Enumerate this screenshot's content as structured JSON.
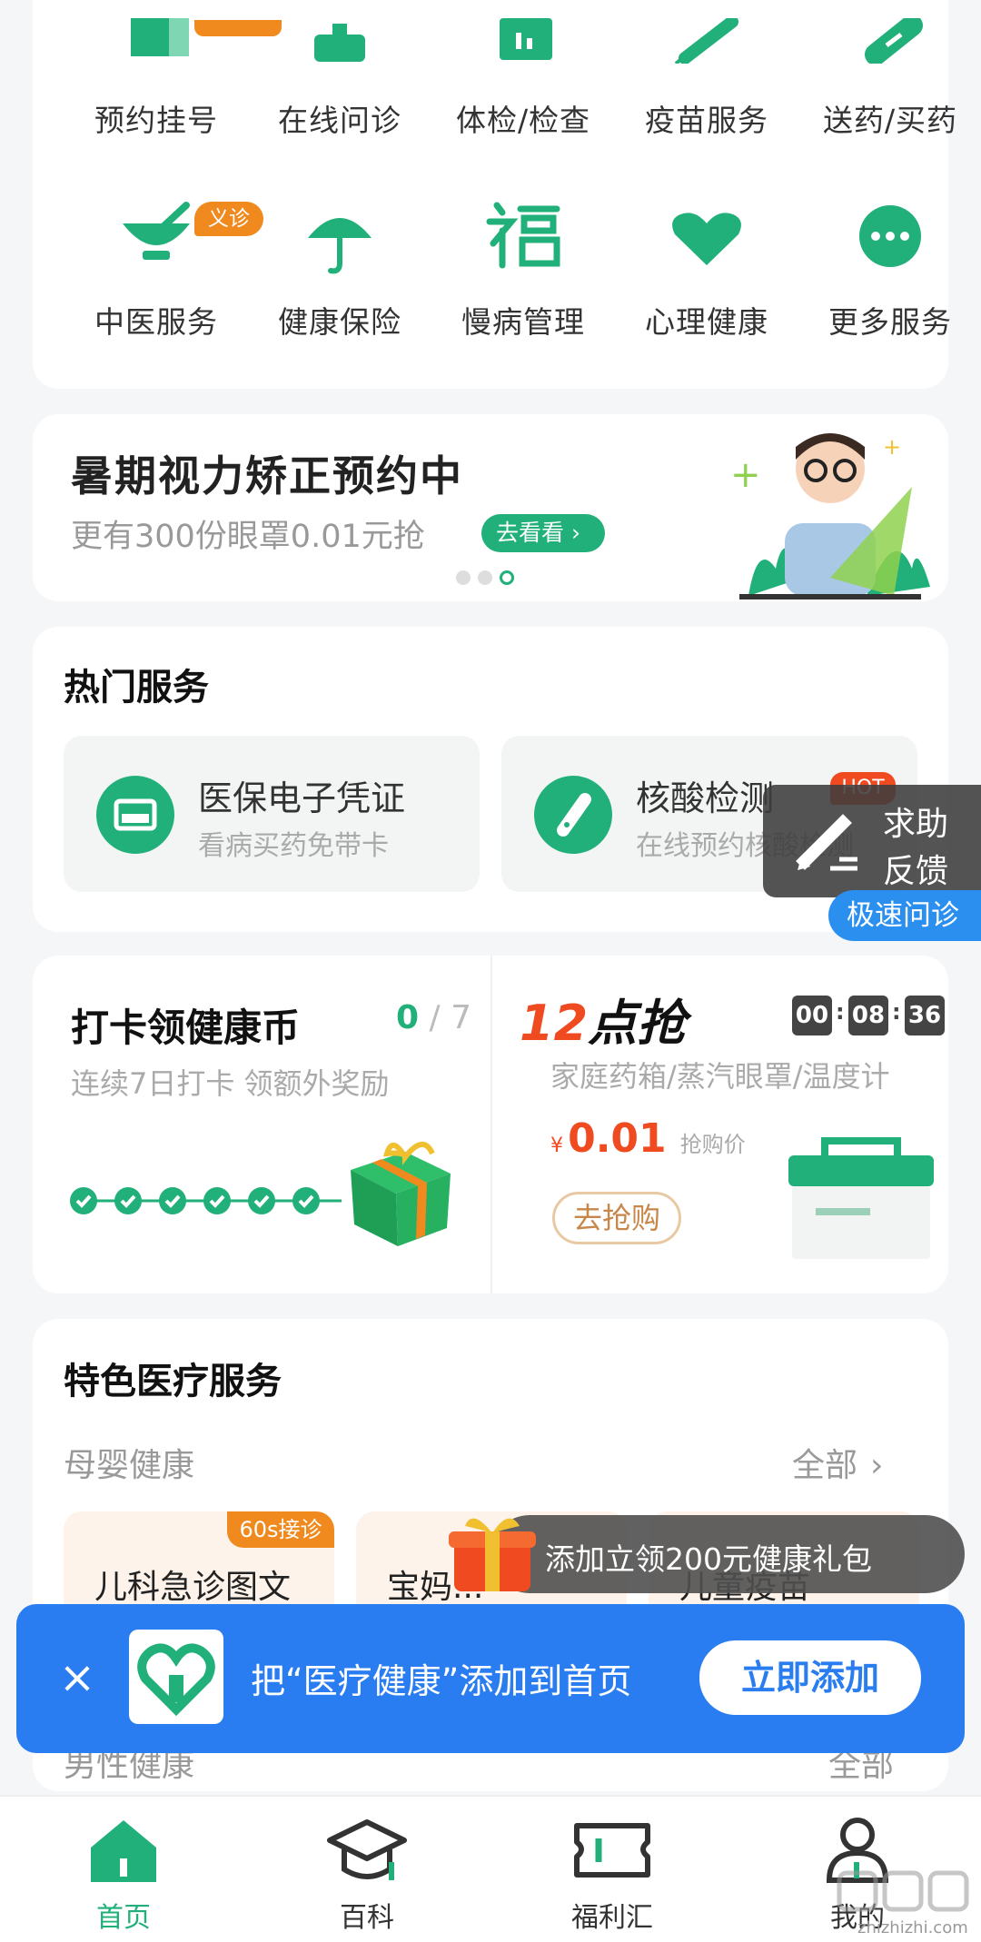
{
  "colors": {
    "accent": "#21b07a",
    "blue": "#2a7df1",
    "orange": "#f08a1e",
    "red": "#f04a20"
  },
  "services": [
    {
      "label": "预约挂号",
      "icon": "calendar-icon"
    },
    {
      "label": "在线问诊",
      "icon": "doctor-icon"
    },
    {
      "label": "体检/检查",
      "icon": "clipboard-icon"
    },
    {
      "label": "疫苗服务",
      "icon": "syringe-icon"
    },
    {
      "label": "送药/买药",
      "icon": "pill-icon"
    },
    {
      "label": "中医服务",
      "icon": "mortar-icon",
      "badge": "义诊"
    },
    {
      "label": "健康保险",
      "icon": "umbrella-icon"
    },
    {
      "label": "慢病管理",
      "icon": "fu-icon"
    },
    {
      "label": "心理健康",
      "icon": "heart-icon"
    },
    {
      "label": "更多服务",
      "icon": "more-icon"
    }
  ],
  "banner": {
    "title": "暑期视力矫正预约中",
    "subtitle": "更有300份眼罩0.01元抢",
    "cta": "去看看"
  },
  "hot": {
    "title": "热门服务",
    "items": [
      {
        "title": "医保电子凭证",
        "desc": "看病买药免带卡"
      },
      {
        "title": "核酸检测",
        "desc": "在线预约核酸检测",
        "badge": "HOT"
      }
    ]
  },
  "float_feedback": {
    "line1": "求助",
    "line2": "反馈"
  },
  "float_quick": "极速问诊",
  "checkin": {
    "title": "打卡领健康币",
    "count": "0",
    "total": "7",
    "desc": "连续7日打卡 领额外奖励"
  },
  "flash": {
    "title_num": "12",
    "title_text": "点抢",
    "hh": "00",
    "mm": "08",
    "ss": "36",
    "items": "家庭药箱/蒸汽眼罩/温度计",
    "currency": "¥",
    "price": "0.01",
    "price_label": "抢购价",
    "cta": "去抢购"
  },
  "special": {
    "title": "特色医疗服务",
    "section": "母婴健康",
    "all": "全部",
    "cards": [
      {
        "title": "儿科急诊图文",
        "badge": "60s接诊"
      },
      {
        "title": "宝妈..."
      },
      {
        "title": "儿童疫苗"
      }
    ],
    "section2": "男性健康",
    "all2": "全部"
  },
  "gift_toast": "添加立领200元健康礼包",
  "add_bar": {
    "text": "把“医疗健康”添加到首页",
    "button": "立即添加"
  },
  "tabs": [
    {
      "label": "首页",
      "active": true
    },
    {
      "label": "百科"
    },
    {
      "label": "福利汇"
    },
    {
      "label": "我的"
    }
  ],
  "watermark": "zhizhizhi.com"
}
